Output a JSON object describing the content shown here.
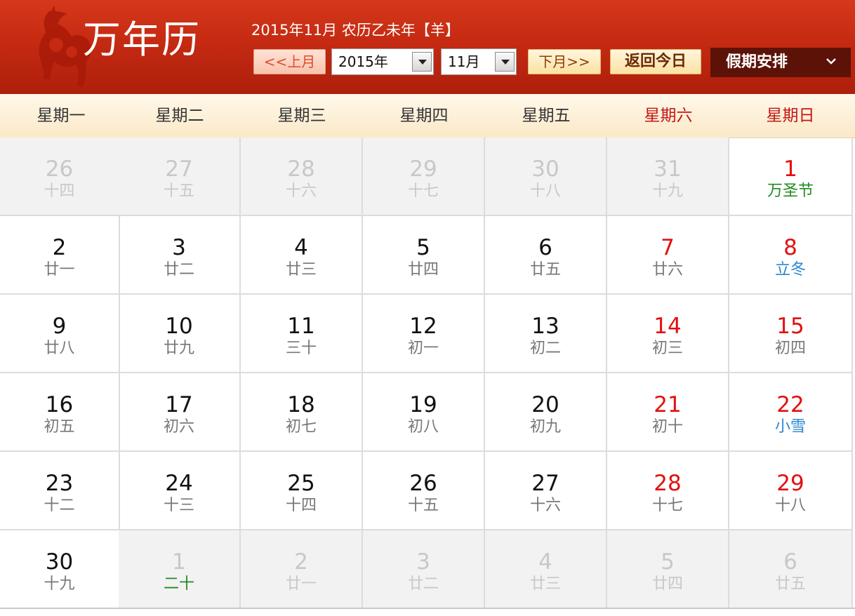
{
  "header": {
    "app_title": "万年历",
    "date_info": "2015年11月 农历乙未年【羊】",
    "prev_month": "<<上月",
    "next_month": "下月>>",
    "today": "返回今日",
    "year_value": "2015年",
    "month_value": "11月",
    "holiday": "假期安排",
    "icons": [
      "goat-logo",
      "chevron-down-icon"
    ]
  },
  "weekdays": [
    "星期一",
    "星期二",
    "星期三",
    "星期四",
    "星期五",
    "星期六",
    "星期日"
  ],
  "colors": {
    "accent": "#c52a12",
    "weekend": "#e21010",
    "festival": "#228b22",
    "solar_term": "#2a86cf"
  },
  "weeks": [
    [
      {
        "day": "26",
        "lunar": "十四",
        "other": true
      },
      {
        "day": "27",
        "lunar": "十五",
        "other": true
      },
      {
        "day": "28",
        "lunar": "十六",
        "other": true
      },
      {
        "day": "29",
        "lunar": "十七",
        "other": true
      },
      {
        "day": "30",
        "lunar": "十八",
        "other": true
      },
      {
        "day": "31",
        "lunar": "十九",
        "other": true
      },
      {
        "day": "1",
        "lunar": "万圣节",
        "kind": "festival"
      }
    ],
    [
      {
        "day": "2",
        "lunar": "廿一"
      },
      {
        "day": "3",
        "lunar": "廿二"
      },
      {
        "day": "4",
        "lunar": "廿三"
      },
      {
        "day": "5",
        "lunar": "廿四"
      },
      {
        "day": "6",
        "lunar": "廿五"
      },
      {
        "day": "7",
        "lunar": "廿六"
      },
      {
        "day": "8",
        "lunar": "立冬",
        "kind": "solar-term"
      }
    ],
    [
      {
        "day": "9",
        "lunar": "廿八"
      },
      {
        "day": "10",
        "lunar": "廿九"
      },
      {
        "day": "11",
        "lunar": "三十"
      },
      {
        "day": "12",
        "lunar": "初一"
      },
      {
        "day": "13",
        "lunar": "初二"
      },
      {
        "day": "14",
        "lunar": "初三"
      },
      {
        "day": "15",
        "lunar": "初四"
      }
    ],
    [
      {
        "day": "16",
        "lunar": "初五"
      },
      {
        "day": "17",
        "lunar": "初六"
      },
      {
        "day": "18",
        "lunar": "初七"
      },
      {
        "day": "19",
        "lunar": "初八"
      },
      {
        "day": "20",
        "lunar": "初九"
      },
      {
        "day": "21",
        "lunar": "初十"
      },
      {
        "day": "22",
        "lunar": "小雪",
        "kind": "solar-term"
      }
    ],
    [
      {
        "day": "23",
        "lunar": "十二"
      },
      {
        "day": "24",
        "lunar": "十三"
      },
      {
        "day": "25",
        "lunar": "十四"
      },
      {
        "day": "26",
        "lunar": "十五"
      },
      {
        "day": "27",
        "lunar": "十六"
      },
      {
        "day": "28",
        "lunar": "十七"
      },
      {
        "day": "29",
        "lunar": "十八"
      }
    ],
    [
      {
        "day": "30",
        "lunar": "十九"
      },
      {
        "day": "1",
        "lunar": "二十",
        "other": true,
        "kind": "festival"
      },
      {
        "day": "2",
        "lunar": "廿一",
        "other": true
      },
      {
        "day": "3",
        "lunar": "廿二",
        "other": true
      },
      {
        "day": "4",
        "lunar": "廿三",
        "other": true
      },
      {
        "day": "5",
        "lunar": "廿四",
        "other": true
      },
      {
        "day": "6",
        "lunar": "廿五",
        "other": true
      }
    ]
  ]
}
